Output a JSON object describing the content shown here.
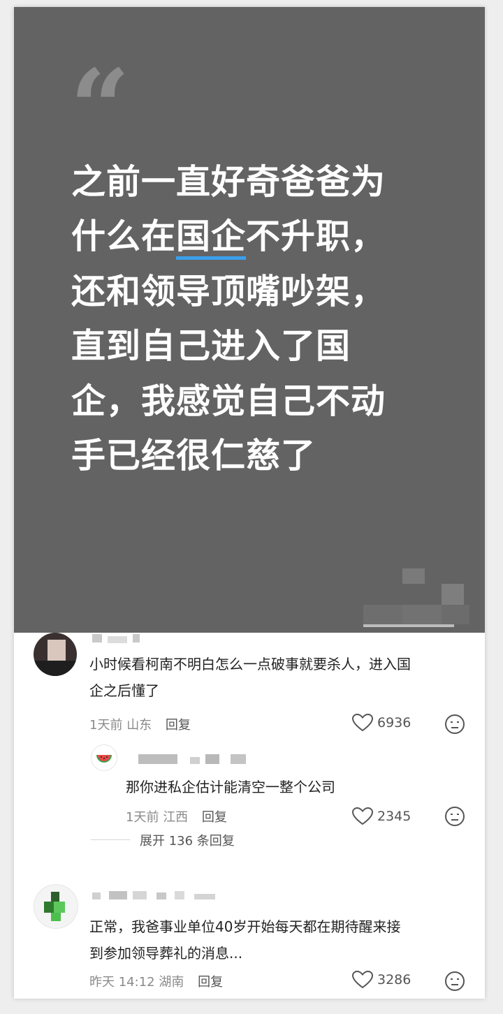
{
  "post": {
    "quote_mark": "“",
    "lines": [
      "之前一直好奇爸爸为",
      "什么在",
      "国企",
      "不升职，",
      "还和领导顶嘴吵架，",
      "直到自己进入了国",
      "企，我感觉自己不动",
      "手已经很仁慈了"
    ]
  },
  "comments": [
    {
      "text_line1": "小时候看柯南不明白怎么一点破事就要杀人，进入国",
      "text_line2": "企之后懂了",
      "time": "1天前",
      "location": "山东",
      "reply_label": "回复",
      "likes": "6936"
    },
    {
      "text": "那你进私企估计能清空一整个公司",
      "time": "1天前",
      "location": "江西",
      "reply_label": "回复",
      "likes": "2345"
    },
    {
      "text_line1": "正常，我爸事业单位40岁开始每天都在期待醒来接",
      "text_line2": "到参加领导葬礼的消息...",
      "time": "昨天 14:12",
      "location": "湖南",
      "reply_label": "回复",
      "likes": "3286"
    }
  ],
  "expand_replies": "展开 136 条回复",
  "colors": {
    "card_bg": "#636363",
    "highlight": "#3aa0ec",
    "text": "#222222",
    "muted": "#8a8a8a"
  }
}
